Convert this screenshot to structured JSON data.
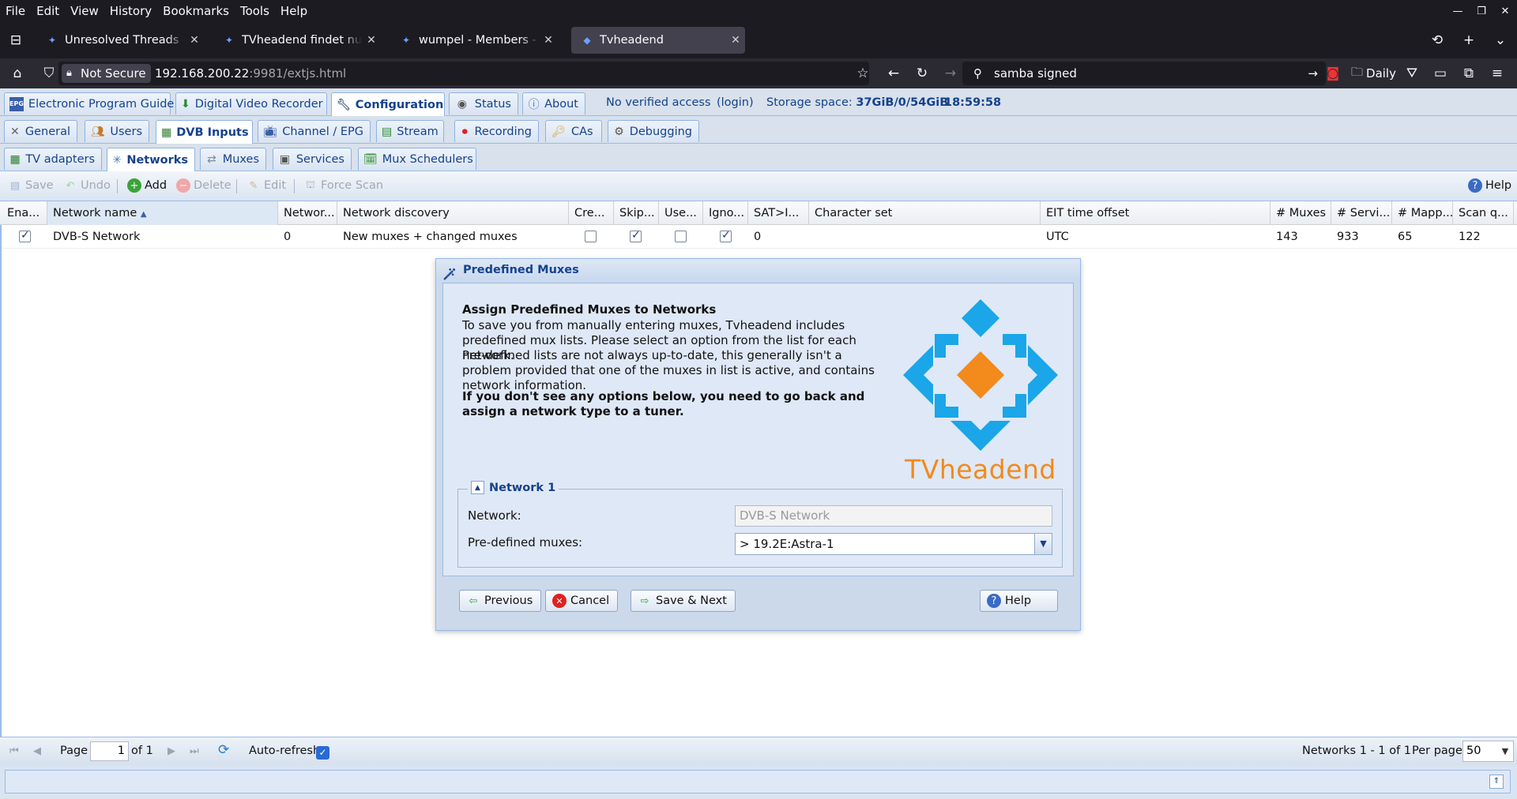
{
  "browser": {
    "menu": [
      "File",
      "Edit",
      "View",
      "History",
      "Bookmarks",
      "Tools",
      "Help"
    ],
    "tabs": [
      {
        "title": "Unresolved Threads - Kodi"
      },
      {
        "title": "TVheadend findet nur Mu"
      },
      {
        "title": "wumpel - Members - Kodi"
      },
      {
        "title": "Tvheadend"
      }
    ],
    "security": "Not Secure",
    "url_host": "192.168.200.22",
    "url_rest": ":9981/extjs.html",
    "search": "samba signed",
    "bookmark_folder": "Daily"
  },
  "app": {
    "top_tabs": [
      "Electronic Program Guide",
      "Digital Video Recorder",
      "Configuration",
      "Status",
      "About"
    ],
    "access": "No verified access",
    "login": "(login)",
    "storage_label": "Storage space:",
    "storage_value": "37GiB/0/54GiB",
    "time": "18:59:58",
    "config_tabs": [
      "General",
      "Users",
      "DVB Inputs",
      "Channel / EPG",
      "Stream",
      "Recording",
      "CAs",
      "Debugging"
    ],
    "dvb_tabs": [
      "TV adapters",
      "Networks",
      "Muxes",
      "Services",
      "Mux Schedulers"
    ],
    "toolbar": {
      "save": "Save",
      "undo": "Undo",
      "add": "Add",
      "delete": "Delete",
      "edit": "Edit",
      "force_scan": "Force Scan",
      "help": "Help"
    },
    "grid": {
      "columns": [
        "Ena...",
        "Network name",
        "Networ...",
        "Network discovery",
        "Cre...",
        "Skip...",
        "Use...",
        "Igno...",
        "SAT>I...",
        "Character set",
        "EIT time offset",
        "# Muxes",
        "# Servi...",
        "# Mapp...",
        "Scan q..."
      ],
      "rows": [
        {
          "enabled": true,
          "name": "DVB-S Network",
          "network_id": "0",
          "discovery": "New muxes + changed muxes",
          "create": false,
          "skip": true,
          "use": false,
          "ignore": true,
          "satip": "0",
          "charset": "",
          "eit_offset": "UTC",
          "muxes": "143",
          "services": "933",
          "mapped": "65",
          "scan_q": "122"
        }
      ]
    },
    "pager": {
      "page_label": "Page",
      "page": "1",
      "of": "of 1",
      "autorefresh": "Auto-refresh",
      "summary": "Networks 1 - 1 of 1",
      "per_page_label": "Per page",
      "per_page": "50"
    }
  },
  "dialog": {
    "title": "Predefined Muxes",
    "heading": "Assign Predefined Muxes to Networks",
    "p1": "To save you from manually entering muxes, Tvheadend includes predefined mux lists. Please select an option from the list for each network.",
    "p2": "Pre-defined lists are not always up-to-date, this generally isn't a problem provided that one of the muxes in list is active, and contains network information.",
    "p3": "If you don't see any options below, you need to go back and assign a network type to a tuner.",
    "logo_text": "TVheadend",
    "fieldset_title": "Network 1",
    "network_label": "Network:",
    "network_value": "DVB-S Network",
    "predef_label": "Pre-defined muxes:",
    "predef_value": "> 19.2E:Astra-1",
    "buttons": {
      "previous": "Previous",
      "cancel": "Cancel",
      "save_next": "Save & Next",
      "help": "Help"
    }
  }
}
